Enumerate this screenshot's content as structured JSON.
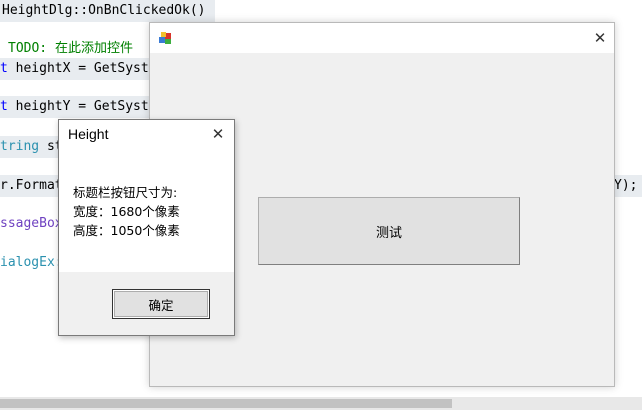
{
  "editor": {
    "lines": [
      {
        "parts": [
          {
            "text": "HeightDlg::OnBnClickedOk()",
            "cls": ""
          }
        ]
      },
      {
        "parts": [
          {
            "text": "TODO: 在此添加控件",
            "cls": "cmt"
          }
        ]
      },
      {
        "parts": [
          {
            "text": "t",
            "cls": "kw"
          },
          {
            "text": " heightX = GetSyst",
            "cls": ""
          }
        ]
      },
      {
        "parts": [
          {
            "text": "t",
            "cls": "kw"
          },
          {
            "text": " heightY = GetSyst",
            "cls": ""
          }
        ]
      },
      {
        "parts": [
          {
            "text": "tring",
            "cls": "cls"
          },
          {
            "text": " st",
            "cls": ""
          }
        ]
      },
      {
        "parts": [
          {
            "text": "r.Format",
            "cls": ""
          }
        ]
      },
      {
        "parts": [
          {
            "text": "ssageBox",
            "cls": "fn"
          }
        ]
      },
      {
        "parts": [
          {
            "text": "ialogEx:",
            "cls": "cls"
          }
        ]
      }
    ],
    "right_fragment": "Y);"
  },
  "main_window": {
    "close_glyph": "✕",
    "test_button_label": "测试"
  },
  "message_box": {
    "title": "Height",
    "close_glyph": "✕",
    "line1": "标题栏按钮尺寸为:",
    "line2": "宽度：1680个像素",
    "line3": "高度：1050个像素",
    "ok_label": "确定"
  }
}
